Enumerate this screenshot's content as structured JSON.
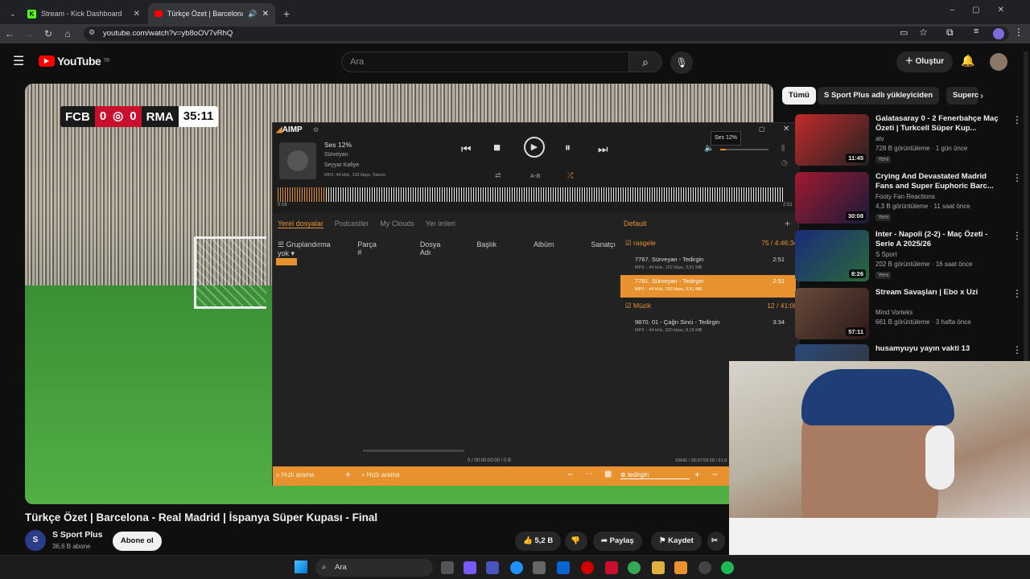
{
  "browser": {
    "tabs": [
      {
        "label": "Stream - Kick Dashboard"
      },
      {
        "label": "Türkçe Özet | Barcelona - R"
      }
    ],
    "url": "youtube.com/watch?v=yb8oOV7vRhQ"
  },
  "youtube": {
    "logo": "YouTube",
    "region": "TR",
    "search_placeholder": "Ara",
    "create_label": "Oluştur",
    "video_title": "Türkçe Özet | Barcelona - Real Madrid | İspanya Süper Kupası - Final",
    "channel_name": "S Sport Plus",
    "subscribers": "36,6 B abone",
    "subscribe_label": "Abone ol",
    "likes": "5,2 B",
    "share_label": "Paylaş",
    "save_label": "Kaydet",
    "scoreboard": {
      "home": "FCB",
      "home_score": "0",
      "away_score": "0",
      "away": "RMA",
      "clock": "35:11"
    }
  },
  "chips": [
    "Tümü",
    "S Sport Plus adlı yükleyiciden",
    "Superco"
  ],
  "related": [
    {
      "title": "Galatasaray 0 - 2 Fenerbahçe Maç Özeti | Turkcell Süper Kup...",
      "channel": "atv",
      "meta": "728 B görüntüleme · 1 gün önce",
      "badge": "Yeni",
      "duration": "11:45",
      "color": "#b32020"
    },
    {
      "title": "Crying And Devastated Madrid Fans and Super Euphoric Barc...",
      "channel": "Footy Fan Reactions",
      "meta": "4,3 B görüntüleme · 11 saat önce",
      "badge": "Yeni",
      "duration": "30:08",
      "color": "#7a1a2a"
    },
    {
      "title": "Inter - Napoli (2-2) - Maç Özeti - Serie A 2025/26",
      "channel": "S Sport",
      "meta": "202 B görüntüleme · 16 saat önce",
      "badge": "Yeni",
      "duration": "8:26",
      "color": "#1a2a6a"
    },
    {
      "title": "Stream Savaşları | Ebo x Uzi",
      "channel": "Mind Vorteks",
      "meta": "661 B görüntüleme · 3 hafta önce",
      "badge": "",
      "duration": "57:11",
      "color": "#5a3a2a"
    },
    {
      "title": "husamyuyu yayın vakti 13",
      "channel": "",
      "meta": "",
      "badge": "",
      "duration": "",
      "color": "#333"
    }
  ],
  "aimp": {
    "logo": "AIMP",
    "volume_label": "Ses 12%",
    "tooltip": "Ses 12%",
    "artist": "Sürveyan",
    "album": "Seyyar Kafiye",
    "format": "MP3, 44 kHz, 192 kbps, Stereo",
    "ab_label": "A-B",
    "time_start": "0:16",
    "time_end": "2:51",
    "volume_level": 0.12,
    "left_tabs": [
      "Yerel dosyalar",
      "Podcastler",
      "My Clouds",
      "Yer imleri"
    ],
    "columns": [
      "Gruplandırma yok",
      "Parça #",
      "Dosya Adı",
      "Başlık",
      "Albüm",
      "Sanatçı"
    ],
    "playlist_tab": "Default",
    "groups": [
      {
        "name": "rasgele",
        "info": "75 / 4:46:34",
        "tracks": [
          {
            "title": "7767. Sürveyan - Tedirgin",
            "duration": "2:51",
            "meta": "MP3 :: 44 kHz, 192 kbps, 3,91 MB",
            "selected": false
          },
          {
            "title": "7781. Sürveyan - Tedirgin",
            "duration": "2:51",
            "meta": "MP3 :: 44 kHz, 192 kbps, 3,91 MB",
            "selected": true
          }
        ]
      },
      {
        "name": "Müzik",
        "info": "12 / 41:00",
        "tracks": [
          {
            "title": "9870. 01 - Çağrı Sinci - Tedirgin",
            "duration": "3:34",
            "meta": "MP3 :: 44 kHz, 320 kbps, 8,15 MB",
            "selected": false
          }
        ]
      }
    ],
    "status_left": "0 / 00:00:00:00 / 0 B",
    "status_right": "10641 / 25:07:59:18 / 51,9",
    "quick_search_1": "Hızlı arama",
    "quick_search_2": "Hızlı arama",
    "search_query": "tedirgin"
  },
  "taskbar": {
    "search_label": "Ara"
  }
}
